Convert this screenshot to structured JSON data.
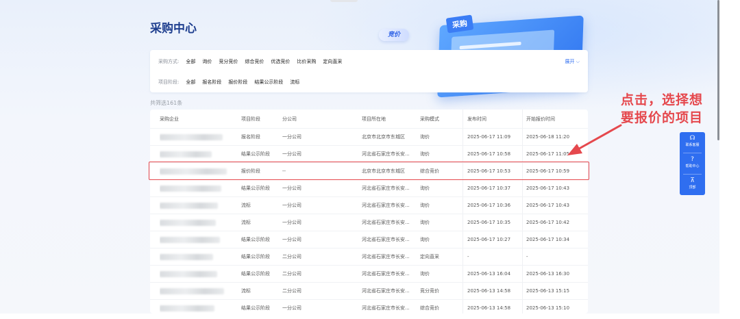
{
  "page": {
    "title": "采购中心",
    "hero_tag": "竞价",
    "hero_label": "采购"
  },
  "filters": {
    "purchase_method": {
      "label": "采购方式:",
      "options": [
        "全部",
        "询价",
        "竞分竞价",
        "综合竞价",
        "优选竞价",
        "比价采购",
        "定向直采"
      ]
    },
    "project_stage": {
      "label": "项目阶段:",
      "options": [
        "全部",
        "报名阶段",
        "报价阶段",
        "结果公示阶段",
        "流标"
      ]
    },
    "expand_label": "展开"
  },
  "result_count": "共筛选161条",
  "table": {
    "columns": [
      "采购企业",
      "项目阶段",
      "分公司",
      "项目所在地",
      "采购模式",
      "发布时间",
      "开始报价时间"
    ],
    "rows": [
      {
        "stage": "报名阶段",
        "branch": "一分公司",
        "location": "北京市北京市东城区",
        "mode": "询价",
        "publish": "2025-06-17 11:09",
        "start": "2025-06-18 11:20"
      },
      {
        "stage": "结果公示阶段",
        "branch": "一分公司",
        "location": "河北省石家庄市长安...",
        "mode": "询价",
        "publish": "2025-06-17 10:58",
        "start": "2025-06-17 11:05"
      },
      {
        "stage": "报价阶段",
        "branch": "--",
        "location": "北京市北京市东城区",
        "mode": "综合竞价",
        "publish": "2025-06-17 10:53",
        "start": "2025-06-17 10:59"
      },
      {
        "stage": "结果公示阶段",
        "branch": "一分公司",
        "location": "河北省石家庄市长安...",
        "mode": "询价",
        "publish": "2025-06-17 10:37",
        "start": "2025-06-17 10:43"
      },
      {
        "stage": "流标",
        "branch": "一分公司",
        "location": "河北省石家庄市长安...",
        "mode": "询价",
        "publish": "2025-06-17 10:36",
        "start": "2025-06-17 10:43"
      },
      {
        "stage": "流标",
        "branch": "一分公司",
        "location": "河北省石家庄市长安...",
        "mode": "询价",
        "publish": "2025-06-17 10:35",
        "start": "2025-06-17 10:42"
      },
      {
        "stage": "结果公示阶段",
        "branch": "一分公司",
        "location": "河北省石家庄市长安...",
        "mode": "询价",
        "publish": "2025-06-17 10:27",
        "start": "2025-06-17 10:34"
      },
      {
        "stage": "结果公示阶段",
        "branch": "二分公司",
        "location": "河北省石家庄市长安...",
        "mode": "定向直采",
        "publish": "-",
        "start": "-"
      },
      {
        "stage": "结果公示阶段",
        "branch": "二分公司",
        "location": "河北省石家庄市长安...",
        "mode": "询价",
        "publish": "2025-06-13 16:04",
        "start": "2025-06-13 16:30"
      },
      {
        "stage": "流标",
        "branch": "二分公司",
        "location": "河北省石家庄市长安...",
        "mode": "竞分竞价",
        "publish": "2025-06-13 14:58",
        "start": "2025-06-13 15:15"
      },
      {
        "stage": "结果公示阶段",
        "branch": "一分公司",
        "location": "河北省石家庄市长安...",
        "mode": "综合竞价",
        "publish": "2025-06-13 14:58",
        "start": "2025-06-13 15:10"
      }
    ]
  },
  "annotation": {
    "line1": "点击，选择想",
    "line2": "要报价的项目"
  },
  "sidebar": {
    "items": [
      {
        "icon": "headset-icon",
        "label": "联系客服"
      },
      {
        "icon": "help-icon",
        "label": "帮助中心"
      },
      {
        "icon": "back-to-top-icon",
        "label": "顶部"
      }
    ]
  },
  "colors": {
    "accent": "#2f6ef0",
    "title": "#1f3f8f",
    "highlight": "#e5484d"
  }
}
